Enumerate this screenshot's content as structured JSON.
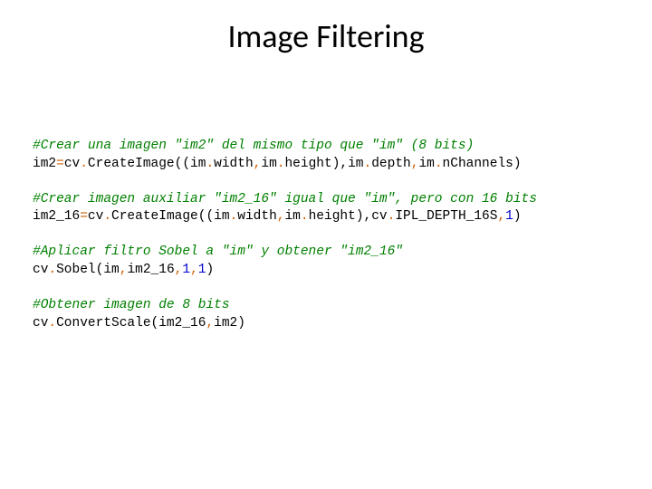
{
  "title": "Image Filtering",
  "code": {
    "c1": "#Crear una imagen \"im2\" del mismo tipo que \"im\" (8 bits)",
    "l1a": "im2",
    "l1b": "=",
    "l1c": "cv",
    "l1d": ".",
    "l1e": "CreateImage",
    "l1f": "((",
    "l1g": "im",
    "l1h": ".",
    "l1i": "width",
    "l1j": ",",
    "l1k": "im",
    "l1l": ".",
    "l1m": "height",
    "l1n": "),",
    "l1o": "im",
    "l1p": ".",
    "l1q": "depth",
    "l1r": ",",
    "l1s": "im",
    "l1t": ".",
    "l1u": "nChannels",
    "l1v": ")",
    "c2": "#Crear imagen auxiliar \"im2_16\" igual que \"im\", pero con 16 bits",
    "l2a": "im2_16",
    "l2b": "=",
    "l2c": "cv",
    "l2d": ".",
    "l2e": "CreateImage",
    "l2f": "((",
    "l2g": "im",
    "l2h": ".",
    "l2i": "width",
    "l2j": ",",
    "l2k": "im",
    "l2l": ".",
    "l2m": "height",
    "l2n": "),",
    "l2o": "cv",
    "l2p": ".",
    "l2q": "IPL_DEPTH_16S",
    "l2r": ",",
    "l2s": "1",
    "l2t": ")",
    "c3": "#Aplicar filtro Sobel a \"im\" y obtener \"im2_16\"",
    "l3a": "cv",
    "l3b": ".",
    "l3c": "Sobel",
    "l3d": "(",
    "l3e": "im",
    "l3f": ",",
    "l3g": "im2_16",
    "l3h": ",",
    "l3i": "1",
    "l3j": ",",
    "l3k": "1",
    "l3l": ")",
    "c4": "#Obtener imagen de 8 bits",
    "l4a": "cv",
    "l4b": ".",
    "l4c": "ConvertScale",
    "l4d": "(",
    "l4e": "im2_16",
    "l4f": ",",
    "l4g": "im2",
    "l4h": ")"
  }
}
